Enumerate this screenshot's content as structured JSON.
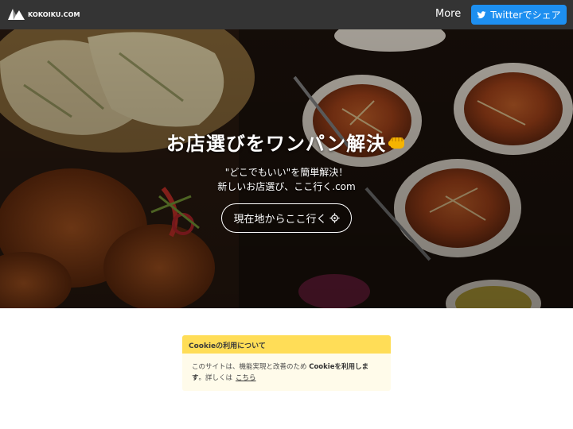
{
  "nav": {
    "logo_text": "KOKOIKU.COM",
    "more_label": "More",
    "twitter_label": "Twitterでシェア"
  },
  "hero": {
    "title": "お店選びをワンパン解決",
    "subtitle_line1": "\"どこでもいい\"を簡単解決！",
    "subtitle_line2": "新しいお店選び、ここ行く.com",
    "locate_button": "現在地からここ行く"
  },
  "cookie": {
    "header": "Cookieの利用について",
    "text_part1": "このサイトは、機能実現と改善のため",
    "text_bold": "Cookieを利用します",
    "text_part2": "。詳しくは",
    "link_text": "こちら"
  },
  "colors": {
    "navbar": "#343434",
    "twitter": "#1d8ff0",
    "cookie_header": "#ffdd57",
    "cookie_body": "#fffbea"
  }
}
